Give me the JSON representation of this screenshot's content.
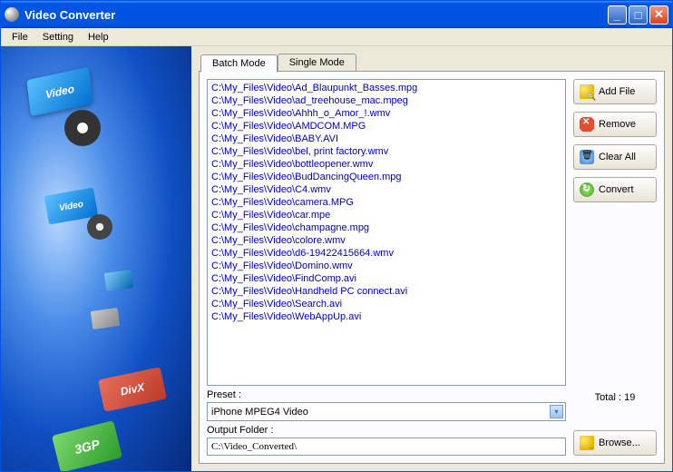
{
  "window": {
    "title": "Video Converter"
  },
  "menu": {
    "file": "File",
    "setting": "Setting",
    "help": "Help"
  },
  "sidebar_labels": {
    "video1": "Video",
    "video2": "Video",
    "divx": "DivX",
    "3gp": "3GP"
  },
  "tabs": {
    "batch": "Batch Mode",
    "single": "Single Mode"
  },
  "files": [
    "C:\\My_Files\\Video\\Ad_Blaupunkt_Basses.mpg",
    "C:\\My_Files\\Video\\ad_treehouse_mac.mpeg",
    "C:\\My_Files\\Video\\Ahhh_o_Amor_!.wmv",
    "C:\\My_Files\\Video\\AMDCOM.MPG",
    "C:\\My_Files\\Video\\BABY.AVI",
    "C:\\My_Files\\Video\\bel, print factory.wmv",
    "C:\\My_Files\\Video\\bottleopener.wmv",
    "C:\\My_Files\\Video\\BudDancingQueen.mpg",
    "C:\\My_Files\\Video\\C4.wmv",
    "C:\\My_Files\\Video\\camera.MPG",
    "C:\\My_Files\\Video\\car.mpe",
    "C:\\My_Files\\Video\\champagne.mpg",
    "C:\\My_Files\\Video\\colore.wmv",
    "C:\\My_Files\\Video\\d6-19422415664.wmv",
    "C:\\My_Files\\Video\\Domino.wmv",
    "C:\\My_Files\\Video\\FindComp.avi",
    "C:\\My_Files\\Video\\Handheld PC connect.avi",
    "C:\\My_Files\\Video\\Search.avi",
    "C:\\My_Files\\Video\\WebAppUp.avi"
  ],
  "buttons": {
    "add": "Add File",
    "remove": "Remove",
    "clear": "Clear All",
    "convert": "Convert",
    "browse": "Browse..."
  },
  "preset": {
    "label": "Preset :",
    "value": "iPhone MPEG4 Video"
  },
  "output": {
    "label": "Output Folder :",
    "value": "C:\\Video_Converted\\"
  },
  "total": {
    "label": "Total : 19"
  }
}
